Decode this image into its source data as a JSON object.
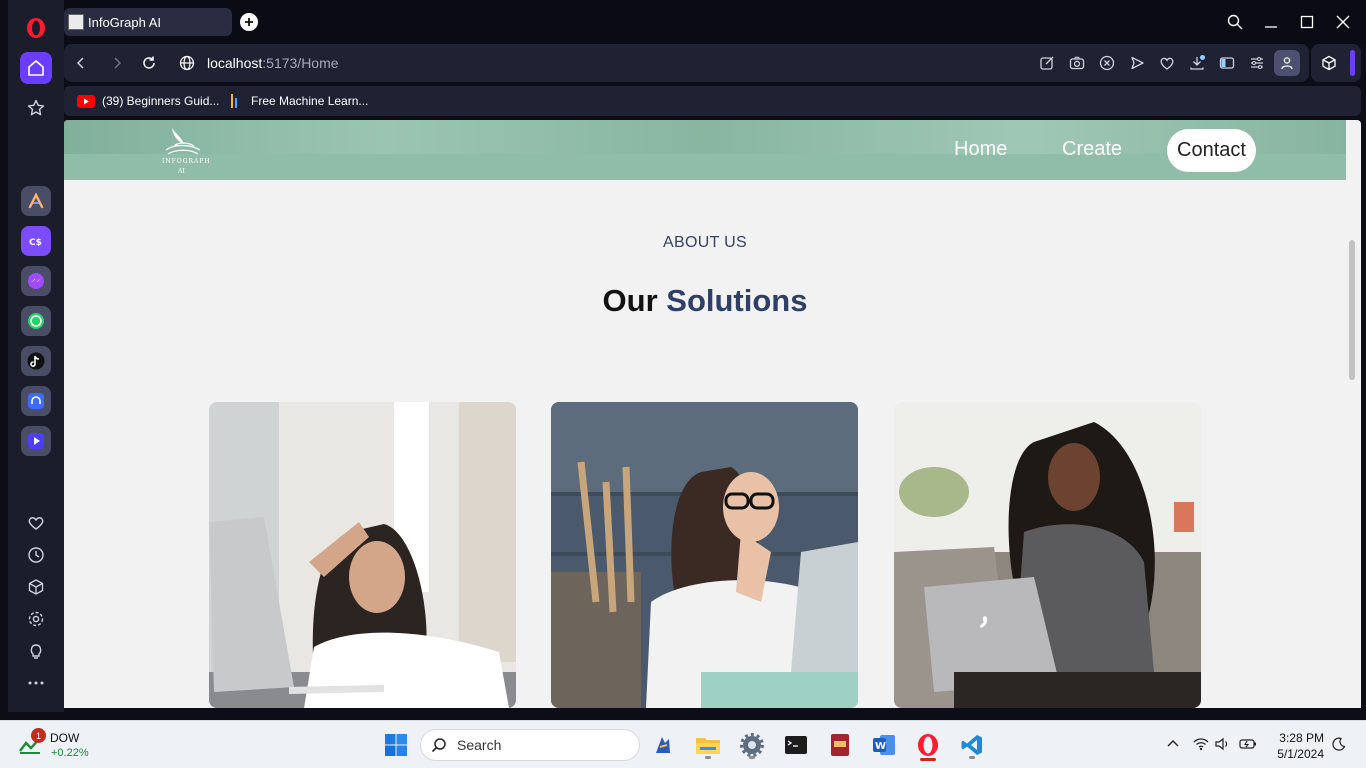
{
  "browser": {
    "tab_title": "InfoGraph AI",
    "url_host": "localhost",
    "url_path": ":5173/Home",
    "bookmarks": [
      {
        "label": "(39) Beginners Guid..."
      },
      {
        "label": "Free Machine Learn..."
      }
    ]
  },
  "site": {
    "logo_text": "INFOGRAPH",
    "logo_sub": "AI",
    "nav": {
      "home": "Home",
      "create": "Create",
      "contact": "Contact"
    },
    "about_label": "ABOUT US",
    "heading_prefix": "Our",
    "heading_accent": "Solutions",
    "cards": [
      {
        "image": "woman-with-laptop-frustrated"
      },
      {
        "image": "woman-with-glasses-thinking"
      },
      {
        "image": "woman-with-laptop-smiling"
      }
    ]
  },
  "taskbar": {
    "widget_name": "DOW",
    "widget_change": "+0.22%",
    "notification_count": "1",
    "search_placeholder": "Search",
    "time": "3:28 PM",
    "date": "5/1/2024"
  },
  "colors": {
    "accent": "#6b3dff",
    "header_green": "#8fbda8",
    "heading_accent": "#2f3f66"
  }
}
